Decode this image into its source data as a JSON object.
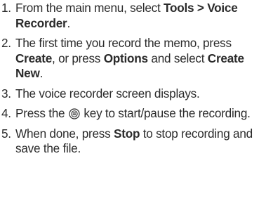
{
  "steps": [
    {
      "num": "1.",
      "parts": [
        {
          "text": "From the main menu, select ",
          "bold": false
        },
        {
          "text": "Tools > Voice Recorder",
          "bold": true
        },
        {
          "text": ".",
          "bold": false
        }
      ]
    },
    {
      "num": "2.",
      "parts": [
        {
          "text": "The first time you record the memo, press ",
          "bold": false
        },
        {
          "text": "Create",
          "bold": true
        },
        {
          "text": ", or press ",
          "bold": false
        },
        {
          "text": "Options",
          "bold": true
        },
        {
          "text": " and select ",
          "bold": false
        },
        {
          "text": "Create New",
          "bold": true
        },
        {
          "text": ".",
          "bold": false
        }
      ]
    },
    {
      "num": "3.",
      "parts": [
        {
          "text": "The voice recorder screen displays.",
          "bold": false
        }
      ]
    },
    {
      "num": "4.",
      "parts": [
        {
          "text": "Press the ",
          "bold": false
        },
        {
          "icon": "center-key-icon"
        },
        {
          "text": " key to start/pause the recording.",
          "bold": false
        }
      ]
    },
    {
      "num": "5.",
      "parts": [
        {
          "text": "When done, press ",
          "bold": false
        },
        {
          "text": "Stop",
          "bold": true
        },
        {
          "text": " to stop recording and save the file.",
          "bold": false
        }
      ]
    }
  ]
}
